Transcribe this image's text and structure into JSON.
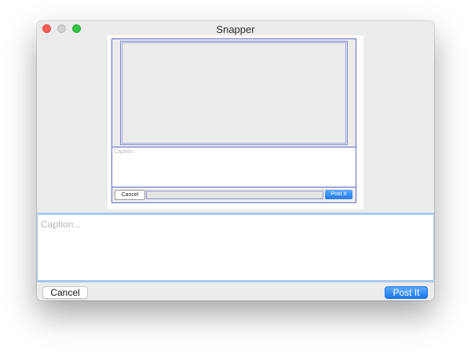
{
  "window": {
    "title": "Snapper"
  },
  "preview": {
    "caption_placeholder": "Caption...",
    "cancel_label": "Cancel",
    "post_label": "Post It"
  },
  "caption": {
    "placeholder": "Caption..."
  },
  "actions": {
    "cancel_label": "Cancel",
    "post_label": "Post It"
  },
  "colors": {
    "accent": "#1b79f2",
    "focus_ring": "#a9c9ee",
    "close": "#fc5f57",
    "zoom": "#33c748"
  }
}
